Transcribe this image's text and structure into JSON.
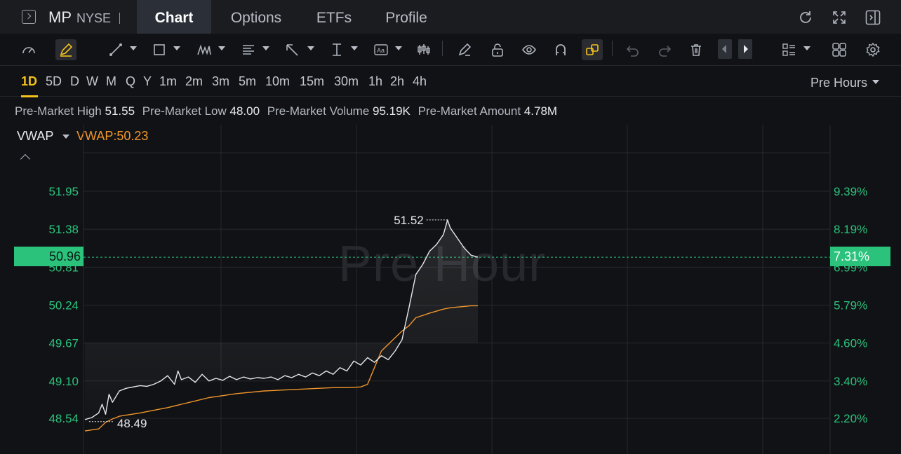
{
  "header": {
    "ticker": "MP",
    "exchange": "NYSE",
    "tabs": [
      {
        "label": "Chart",
        "active": true
      },
      {
        "label": "Options",
        "active": false
      },
      {
        "label": "ETFs",
        "active": false
      },
      {
        "label": "Profile",
        "active": false
      }
    ]
  },
  "periods": {
    "items": [
      "1D",
      "5D",
      "D",
      "W",
      "M",
      "Q",
      "Y",
      "1m",
      "2m",
      "3m",
      "5m",
      "10m",
      "15m",
      "30m",
      "1h",
      "2h",
      "4h"
    ],
    "active": "1D",
    "session_select": "Pre Hours"
  },
  "stats": {
    "high_label": "Pre-Market High",
    "high_value": "51.55",
    "low_label": "Pre-Market Low",
    "low_value": "48.00",
    "volume_label": "Pre-Market Volume",
    "volume_value": "95.19K",
    "amount_label": "Pre-Market Amount",
    "amount_value": "4.78M"
  },
  "indicator": {
    "name": "VWAP",
    "value_text": "VWAP:50.23"
  },
  "chart": {
    "watermark": "Pre Hour",
    "current_price": "50.96",
    "current_pct": "7.31%"
  },
  "colors": {
    "up_green": "#2bc27c",
    "vwap_orange": "#f0962b",
    "price_line": "#e6e7ea",
    "active_period": "#f5c21b",
    "accent_yellow": "#f5c21b"
  },
  "chart_data": {
    "type": "line",
    "y_left_ticks": [
      "51.95",
      "51.38",
      "50.81",
      "50.24",
      "49.67",
      "49.10",
      "48.54"
    ],
    "y_right_ticks": [
      "9.39%",
      "8.19%",
      "6.99%",
      "5.79%",
      "4.60%",
      "3.40%",
      "2.20%"
    ],
    "ylim": [
      48.3,
      52.2
    ],
    "xlim": [
      0,
      100
    ],
    "high_marker": {
      "x": 52.6,
      "y": 51.52,
      "label": "51.52"
    },
    "low_marker": {
      "x": 0.6,
      "y": 48.49,
      "label": "48.49"
    },
    "current_line": 50.96,
    "series": [
      {
        "name": "",
        "color": "#e6e7ea",
        "x": [
          0,
          1,
          2,
          2.5,
          3,
          3.5,
          4,
          5,
          6,
          7,
          8,
          9,
          10,
          11,
          12,
          13,
          13.5,
          14,
          15,
          16,
          17,
          18,
          19,
          20,
          21,
          22,
          23,
          24,
          25,
          26,
          27,
          28,
          29,
          30,
          31,
          32,
          33,
          34,
          35,
          36,
          37,
          38,
          39,
          40,
          41,
          42,
          43,
          44,
          45,
          46,
          47,
          48,
          49,
          50,
          51,
          52,
          52.6,
          53,
          54,
          55,
          56,
          57
        ],
        "y": [
          48.52,
          48.55,
          48.62,
          48.75,
          48.6,
          48.9,
          48.78,
          48.95,
          48.99,
          49.01,
          49.03,
          49.02,
          49.05,
          49.1,
          49.18,
          49.05,
          49.25,
          49.12,
          49.16,
          49.08,
          49.2,
          49.1,
          49.14,
          49.11,
          49.17,
          49.12,
          49.16,
          49.13,
          49.15,
          49.14,
          49.16,
          49.12,
          49.18,
          49.15,
          49.2,
          49.16,
          49.22,
          49.18,
          49.25,
          49.2,
          49.3,
          49.25,
          49.4,
          49.34,
          49.45,
          49.38,
          49.48,
          49.42,
          49.55,
          49.72,
          50.2,
          50.7,
          50.85,
          51.05,
          51.15,
          51.3,
          51.52,
          51.4,
          51.25,
          51.1,
          50.99,
          50.96
        ]
      },
      {
        "name": "VWAP",
        "color": "#f0962b",
        "x": [
          0,
          2,
          3,
          4,
          5,
          8,
          10,
          12,
          14,
          16,
          18,
          20,
          22,
          24,
          26,
          28,
          30,
          32,
          34,
          36,
          38,
          40,
          41,
          42,
          43,
          44,
          45,
          46,
          47,
          48,
          50,
          52,
          53,
          54,
          55,
          56,
          57
        ],
        "y": [
          48.35,
          48.38,
          48.48,
          48.53,
          48.57,
          48.62,
          48.66,
          48.7,
          48.75,
          48.8,
          48.85,
          48.88,
          48.91,
          48.93,
          48.95,
          48.96,
          48.97,
          48.98,
          48.99,
          49.0,
          49.0,
          49.01,
          49.05,
          49.3,
          49.55,
          49.65,
          49.75,
          49.85,
          49.93,
          50.05,
          50.12,
          50.18,
          50.2,
          50.21,
          50.22,
          50.23,
          50.23
        ]
      }
    ]
  }
}
